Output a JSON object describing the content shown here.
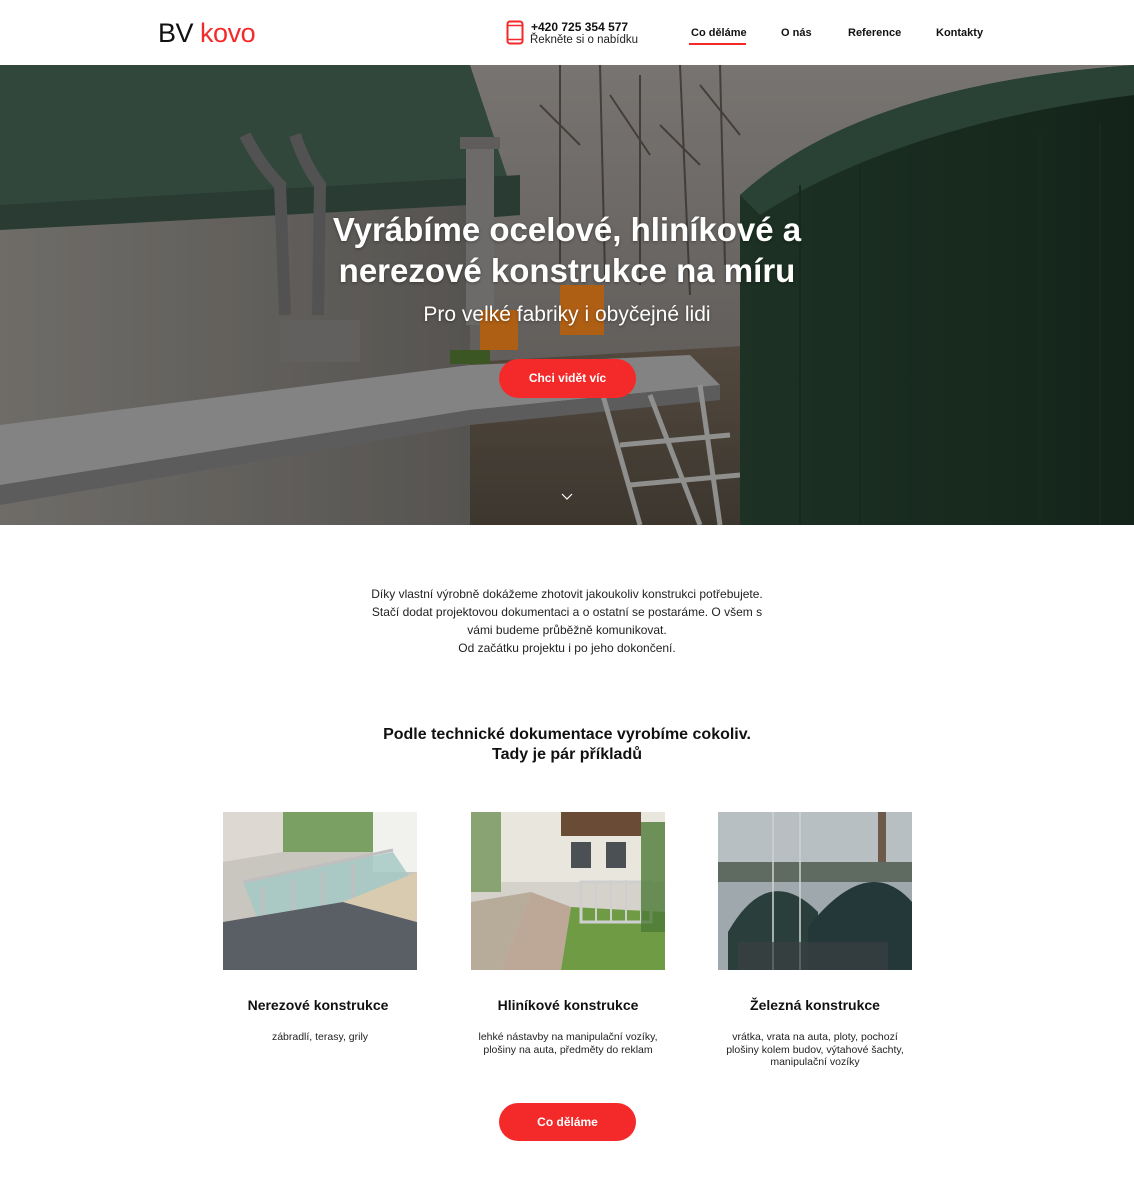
{
  "header": {
    "logo_bv": "BV",
    "logo_kovo": "kovo",
    "phone_number": "+420 725 354 577",
    "phone_cta": "Řekněte si o nabídku",
    "nav": [
      {
        "label": "Co děláme",
        "active": true
      },
      {
        "label": "O nás",
        "active": false
      },
      {
        "label": "Reference",
        "active": false
      },
      {
        "label": "Kontakty",
        "active": false
      }
    ],
    "icon": "phone-icon"
  },
  "hero": {
    "title_line1": "Vyrábíme ocelové, hliníkové a",
    "title_line2": "nerezové konstrukce na míru",
    "subtitle": "Pro velké fabriky i obyčejné lidi",
    "button_label": "Chci vidět víc",
    "scroll_icon": "chevron-down-icon"
  },
  "intro": {
    "lines": [
      "Díky vlastní výrobně dokážeme zhotovit jakoukoliv konstrukci potřebujete.",
      "Stačí dodat projektovou dokumentaci a o ostatní se postaráme. O všem s",
      "vámi budeme průběžně komunikovat.",
      "Od začátku projektu i po jeho dokončení."
    ]
  },
  "examples": {
    "title_line1": "Podle technické dokumentace vyrobíme cokoliv.",
    "title_line2": "Tady je pár příkladů",
    "cards": [
      {
        "title": "Nerezové konstrukce",
        "desc_lines": [
          "zábradlí, terasy, grily"
        ]
      },
      {
        "title": "Hliníkové konstrukce",
        "desc_lines": [
          "lehké nástavby na manipulační vozíky,",
          "plošiny na auta, předměty do reklam"
        ]
      },
      {
        "title": "Železná konstrukce",
        "desc_lines": [
          "vrátka, vrata na auta, ploty, pochozí",
          "plošiny kolem budov, výtahové šachty,",
          "manipulační vozíky"
        ]
      }
    ],
    "button_label": "Co děláme"
  },
  "colors": {
    "accent": "#f42a2a",
    "text": "#111111",
    "background": "#ffffff"
  }
}
